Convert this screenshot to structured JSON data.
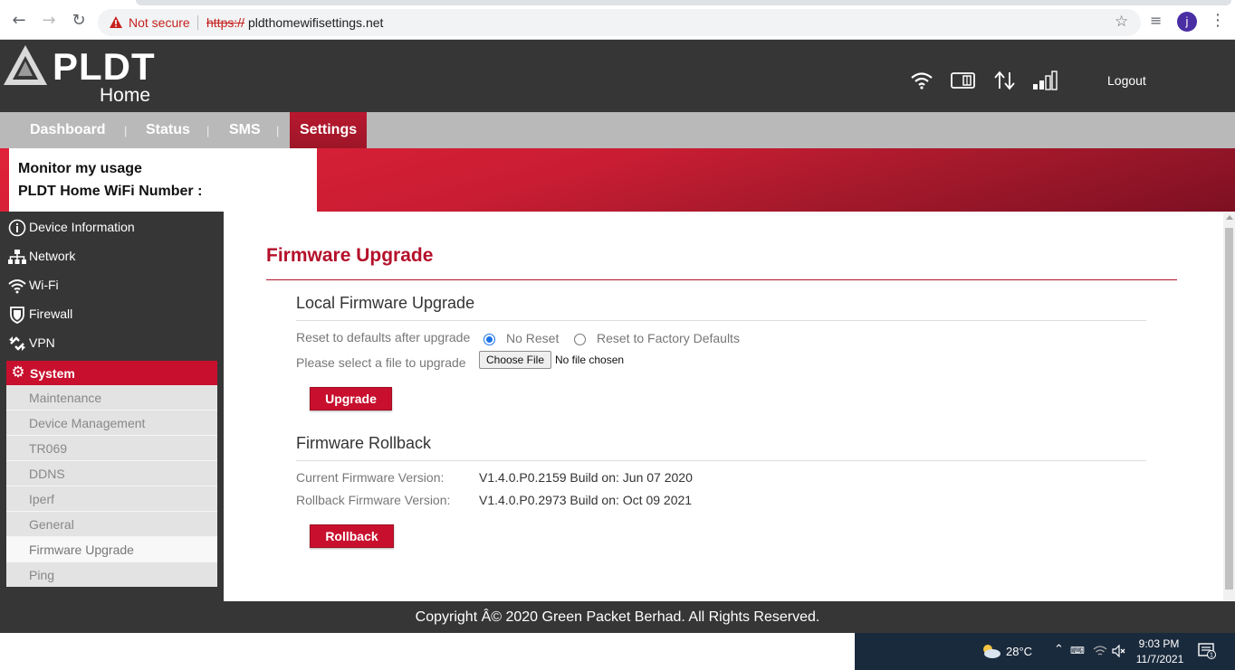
{
  "browser": {
    "security_label": "Not secure",
    "url_scheme": "https://",
    "url_host": "pldthomewifisettings.net",
    "profile_initial": "j"
  },
  "header": {
    "brand": "PLDT",
    "brand_sub": "Home",
    "logout_label": "Logout"
  },
  "nav": {
    "tabs": [
      {
        "label": "Dashboard"
      },
      {
        "label": "Status"
      },
      {
        "label": "SMS"
      },
      {
        "label": "Settings"
      }
    ],
    "separator": "|"
  },
  "banner": {
    "monitor_label": "Monitor my usage",
    "number_label": "PLDT Home WiFi Number :"
  },
  "sidebar": {
    "items": [
      {
        "label": "Device Information",
        "icon": "info-icon"
      },
      {
        "label": "Network",
        "icon": "network-icon"
      },
      {
        "label": "Wi-Fi",
        "icon": "wifi-icon"
      },
      {
        "label": "Firewall",
        "icon": "shield-icon"
      },
      {
        "label": "VPN",
        "icon": "vpn-icon"
      }
    ],
    "system": {
      "label": "System",
      "icon": "gear-icon"
    },
    "submenu": [
      {
        "label": "Maintenance"
      },
      {
        "label": "Device Management"
      },
      {
        "label": "TR069"
      },
      {
        "label": "DDNS"
      },
      {
        "label": "Iperf"
      },
      {
        "label": "General"
      },
      {
        "label": "Firmware Upgrade"
      },
      {
        "label": "Ping"
      }
    ]
  },
  "main": {
    "title": "Firmware Upgrade",
    "local": {
      "title": "Local Firmware Upgrade",
      "reset_label": "Reset to defaults after upgrade",
      "opt_no_reset": "No Reset",
      "opt_factory": "Reset to Factory Defaults",
      "file_label": "Please select a file to upgrade",
      "choose_file": "Choose File",
      "file_status": "No file chosen",
      "upgrade_button": "Upgrade"
    },
    "rollback": {
      "title": "Firmware Rollback",
      "current_label": "Current Firmware Version:",
      "current_value": "V1.4.0.P0.2159 Build on: Jun 07 2020",
      "rollback_label": "Rollback Firmware Version:",
      "rollback_value": "V1.4.0.P0.2973 Build on: Oct 09 2021",
      "rollback_button": "Rollback"
    }
  },
  "footer": {
    "copyright": "Copyright Â© 2020 Green Packet Berhad. All Rights Reserved."
  },
  "taskbar": {
    "temperature": "28°C",
    "time": "9:03 PM",
    "date": "11/7/2021",
    "notification_count": "1"
  },
  "colors": {
    "brand_red": "#c8102e",
    "header_dark": "#363636",
    "nav_gray": "#b9b9b9"
  }
}
